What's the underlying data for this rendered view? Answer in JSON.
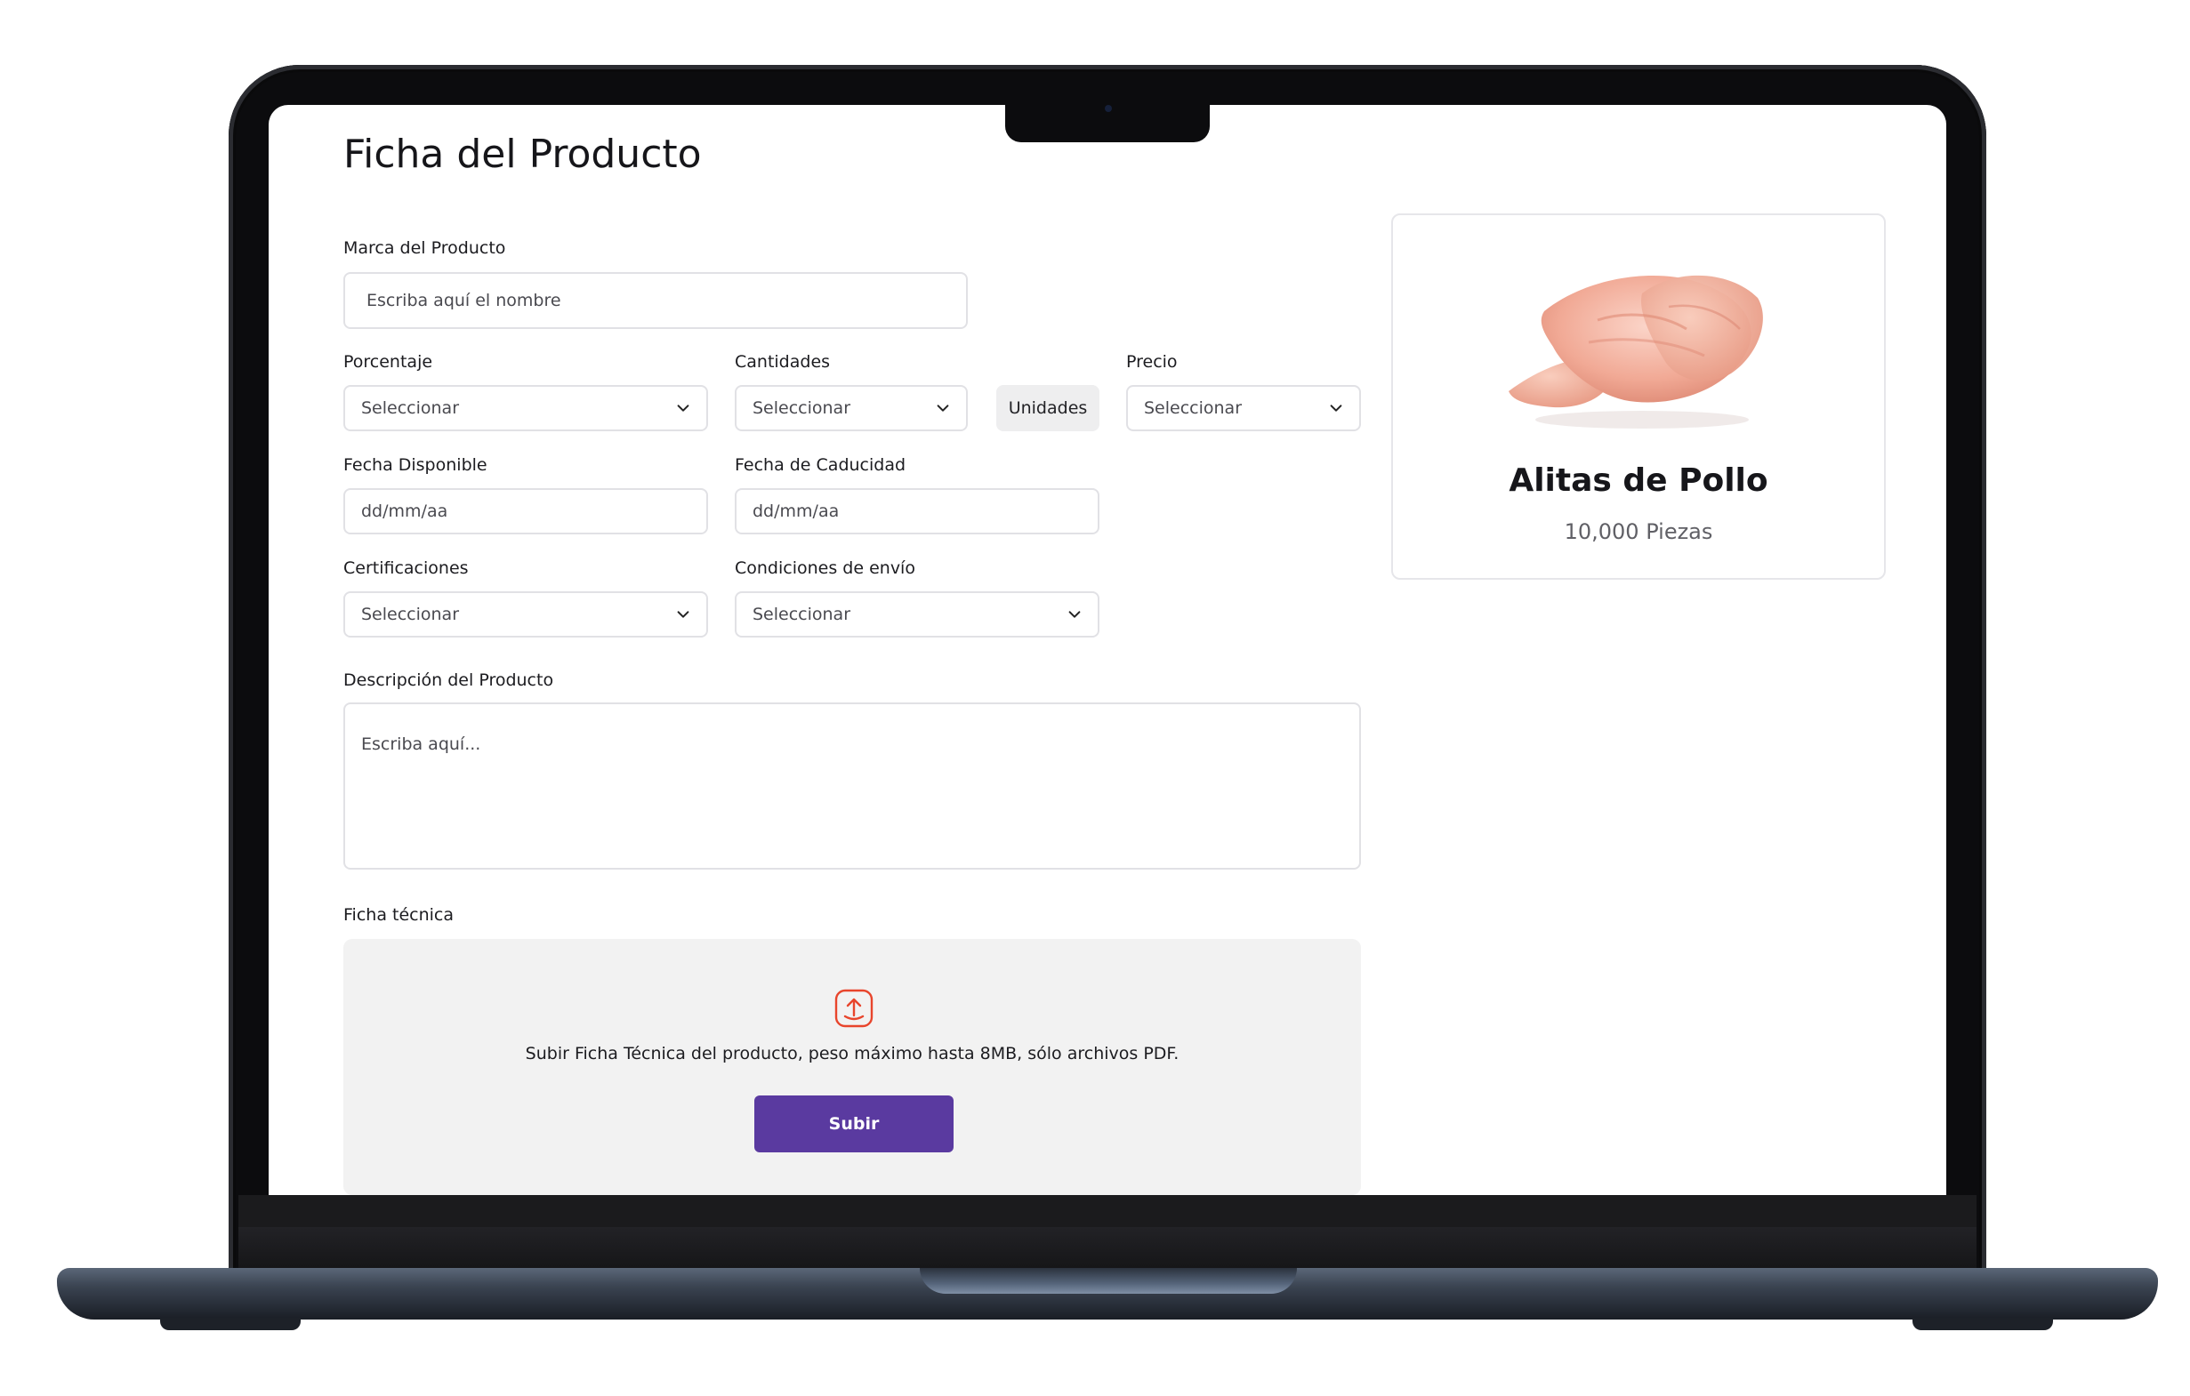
{
  "page": {
    "title": "Ficha del Producto"
  },
  "form": {
    "brand": {
      "label": "Marca del Producto",
      "placeholder": "Escriba aquí el nombre"
    },
    "percentage": {
      "label": "Porcentaje",
      "value": "Seleccionar"
    },
    "quantities": {
      "label": "Cantidades",
      "value": "Seleccionar",
      "unit": "Unidades"
    },
    "price": {
      "label": "Precio",
      "value": "Seleccionar"
    },
    "available_date": {
      "label": "Fecha Disponible",
      "placeholder": "dd/mm/aa"
    },
    "expiry_date": {
      "label": "Fecha de Caducidad",
      "placeholder": "dd/mm/aa"
    },
    "certifications": {
      "label": "Certificaciones",
      "value": "Seleccionar"
    },
    "shipping": {
      "label": "Condiciones de envío",
      "value": "Seleccionar"
    },
    "description": {
      "label": "Descripción del Producto",
      "placeholder": "Escriba aquí..."
    },
    "datasheet": {
      "label": "Ficha técnica",
      "hint": "Subir Ficha Técnica del  producto, peso máximo hasta 8MB, sólo archivos PDF.",
      "button": "Subir",
      "icon": "upload-icon"
    }
  },
  "product": {
    "name": "Alitas de Pollo",
    "quantity": "10,000 Piezas",
    "image": "chicken-wings-photo"
  },
  "colors": {
    "accent": "#5A3AA0",
    "upload_icon": "#E8452C",
    "laptop_body": "#0C0C0E"
  }
}
